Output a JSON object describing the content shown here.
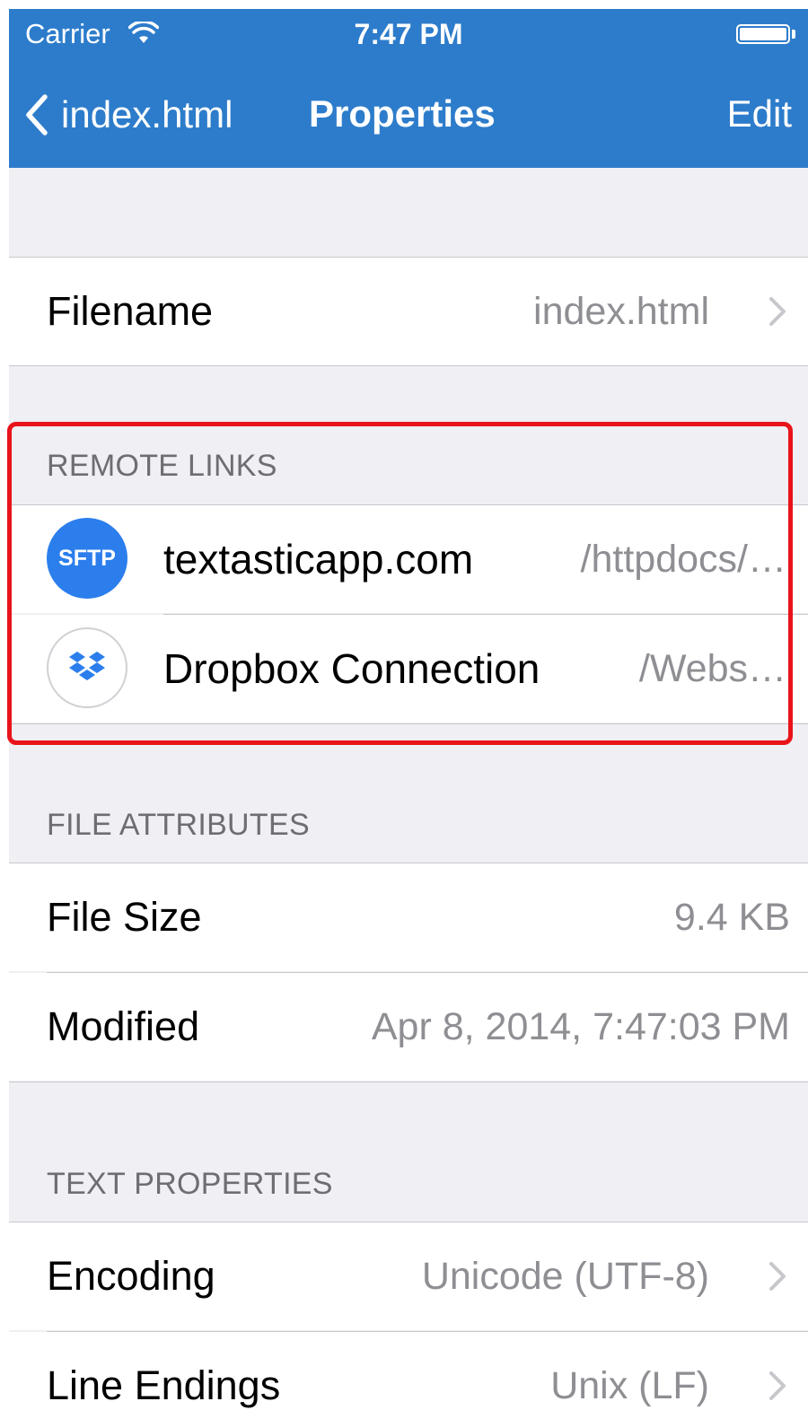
{
  "status_bar": {
    "carrier": "Carrier",
    "time": "7:47 PM"
  },
  "nav": {
    "back_label": "index.html",
    "title": "Properties",
    "edit_label": "Edit",
    "color": "#2d7ccb"
  },
  "filename_row": {
    "label": "Filename",
    "value": "index.html"
  },
  "remote_links": {
    "header": "REMOTE LINKS",
    "items": [
      {
        "icon": "sftp-icon",
        "icon_text": "SFTP",
        "name": "textasticapp.com",
        "path": "/httpdocs/…"
      },
      {
        "icon": "dropbox-icon",
        "name": "Dropbox Connection",
        "path": "/Webs…"
      }
    ],
    "highlight_color": "#e8141a"
  },
  "file_attributes": {
    "header": "FILE ATTRIBUTES",
    "rows": [
      {
        "label": "File Size",
        "value": "9.4 KB"
      },
      {
        "label": "Modified",
        "value": "Apr 8, 2014, 7:47:03 PM"
      }
    ]
  },
  "text_properties": {
    "header": "TEXT PROPERTIES",
    "rows": [
      {
        "label": "Encoding",
        "value": "Unicode (UTF-8)"
      },
      {
        "label": "Line Endings",
        "value": "Unix (LF)"
      }
    ]
  }
}
